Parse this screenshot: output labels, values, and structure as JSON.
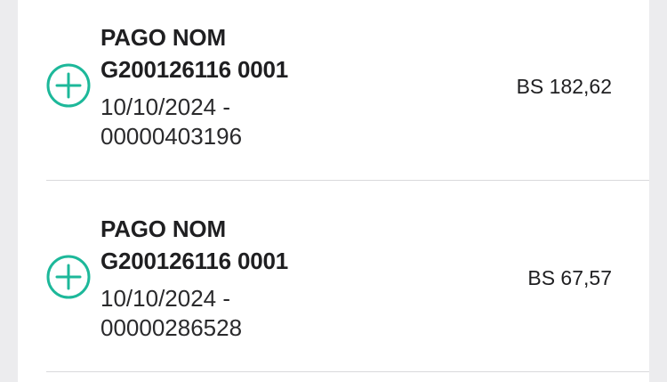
{
  "accent_color": "#1db89a",
  "transactions": [
    {
      "icon": "plus-circle-icon",
      "title_line1": "PAGO NOM",
      "title_line2": "G200126116 0001",
      "date_line": "10/10/2024 -",
      "reference": "00000403196",
      "amount": "BS 182,62"
    },
    {
      "icon": "plus-circle-icon",
      "title_line1": "PAGO NOM",
      "title_line2": "G200126116 0001",
      "date_line": "10/10/2024 -",
      "reference": "00000286528",
      "amount": "BS 67,57"
    }
  ]
}
